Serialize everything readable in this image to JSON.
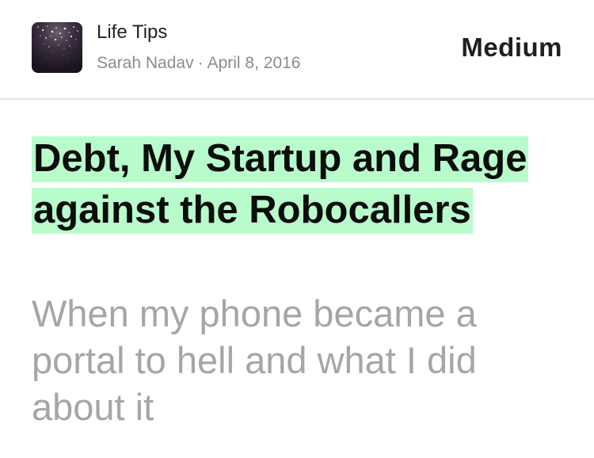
{
  "header": {
    "publication_name": "Life Tips",
    "author": "Sarah Nadav",
    "separator": "·",
    "date": "April 8, 2016",
    "logo_text": "Medium",
    "avatar_icon": "publication-avatar-icon"
  },
  "article": {
    "title": "Debt, My Startup and Rage against the Robocallers",
    "subtitle": "When my phone became a portal to hell and what I did about it"
  },
  "colors": {
    "title_highlight": "#b8fccb",
    "subtitle_text": "#a6a6a6",
    "meta_text": "#8c8c8c",
    "divider": "#e6e6e6"
  }
}
